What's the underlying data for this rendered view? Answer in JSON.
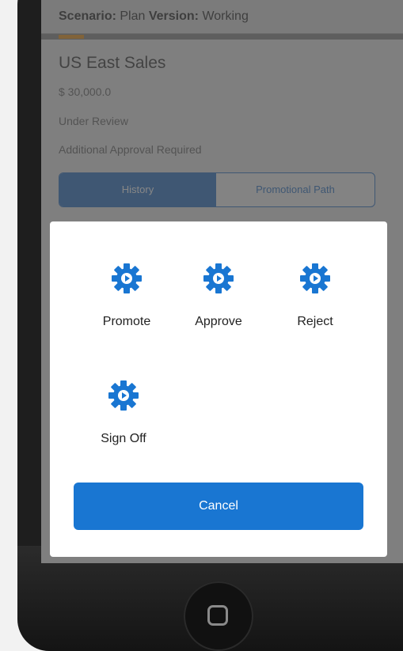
{
  "header": {
    "scenario_label": "Scenario:",
    "scenario_value": "Plan",
    "version_label": "Version:",
    "version_value": "Working"
  },
  "item": {
    "title": "US East Sales",
    "amount": "$ 30,000.0",
    "status": "Under Review",
    "note": "Additional Approval Required"
  },
  "tabs": {
    "history": "History",
    "promotional_path": "Promotional Path"
  },
  "actions": [
    {
      "label": "Promote",
      "icon": "gear-play-icon"
    },
    {
      "label": "Approve",
      "icon": "gear-play-icon"
    },
    {
      "label": "Reject",
      "icon": "gear-play-icon"
    },
    {
      "label": "Sign Off",
      "icon": "gear-play-icon"
    }
  ],
  "cancel_label": "Cancel",
  "colors": {
    "accent": "#1976d2",
    "status_orange": "#f08a00"
  }
}
